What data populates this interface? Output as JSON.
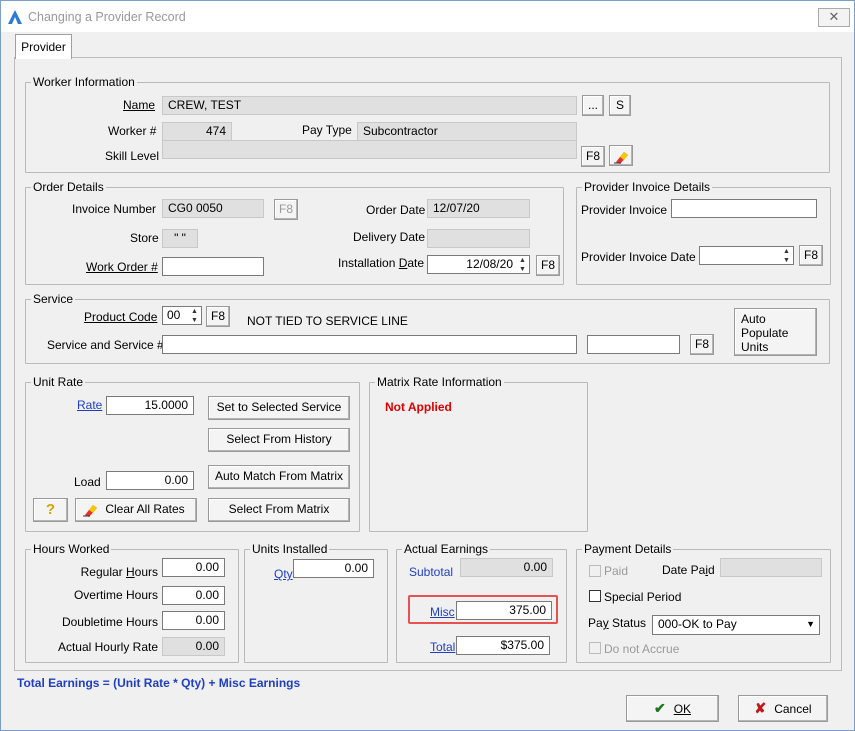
{
  "window": {
    "title": "Changing a Provider Record",
    "close_symbol": "✕"
  },
  "tabs": [
    {
      "label": "Provider"
    }
  ],
  "worker_info": {
    "title": "Worker Information",
    "name_label": "Name",
    "name_value": "CREW, TEST",
    "ellipsis_label": "...",
    "s_label": "S",
    "worker_num_label": "Worker #",
    "worker_num_value": "474",
    "pay_type_label": "Pay Type",
    "pay_type_value": "Subcontractor",
    "skill_level_label": "Skill Level",
    "skill_level_value": "",
    "f8_label": "F8"
  },
  "order_details": {
    "title": "Order Details",
    "invoice_number_label": "Invoice Number",
    "invoice_number_value": "CG0 0050",
    "f8_label": "F8",
    "store_label": "Store",
    "store_value": "\" \"",
    "work_order_label": "Work Order #",
    "work_order_value": "",
    "order_date_label": "Order Date",
    "order_date_value": "12/07/20",
    "delivery_date_label": "Delivery Date",
    "delivery_date_value": "",
    "installation_date_label": "Installation Date",
    "installation_date_value": "12/08/20",
    "f8_label2": "F8"
  },
  "provider_invoice": {
    "title": "Provider Invoice Details",
    "invoice_label": "Provider Invoice",
    "invoice_value": "",
    "invoice_date_label": "Provider Invoice Date",
    "invoice_date_value": "",
    "f8_label": "F8"
  },
  "service": {
    "title": "Service",
    "product_code_label": "Product Code",
    "product_code_value": "00",
    "f8_label": "F8",
    "not_tied_text": "NOT TIED TO SERVICE LINE",
    "service_label": "Service and Service #",
    "service_value": "",
    "service_num_value": "",
    "f8_label2": "F8",
    "auto_populate_line1": "Auto",
    "auto_populate_line2": "Populate",
    "auto_populate_line3": "Units"
  },
  "unit_rate": {
    "title": "Unit Rate",
    "rate_label": "Rate",
    "rate_value": "15.0000",
    "load_label": "Load",
    "load_value": "0.00",
    "set_selected_label": "Set to Selected Service",
    "select_history_label": "Select From History",
    "auto_match_label": "Auto Match From Matrix",
    "select_matrix_label": "Select From Matrix",
    "help_symbol": "?",
    "clear_rates_label": "Clear All Rates"
  },
  "matrix_rate": {
    "title": "Matrix Rate Information",
    "status_text": "Not Applied"
  },
  "hours_worked": {
    "title": "Hours Worked",
    "regular_label": "Regular Hours",
    "regular_value": "0.00",
    "overtime_label": "Overtime Hours",
    "overtime_value": "0.00",
    "doubletime_label": "Doubletime Hours",
    "doubletime_value": "0.00",
    "actual_rate_label": "Actual Hourly Rate",
    "actual_rate_value": "0.00"
  },
  "units_installed": {
    "title": "Units Installed",
    "qty_label": "Qty",
    "qty_value": "0.00"
  },
  "actual_earnings": {
    "title": "Actual Earnings",
    "subtotal_label": "Subtotal",
    "subtotal_value": "0.00",
    "misc_label": "Misc",
    "misc_value": "375.00",
    "total_label": "Total",
    "total_value": "$375.00"
  },
  "payment_details": {
    "title": "Payment Details",
    "paid_label": "Paid",
    "date_paid_label": "Date Paid",
    "date_paid_value": "",
    "special_period_label": "Special Period",
    "pay_status_label": "Pay Status",
    "pay_status_value": "000-OK to Pay",
    "do_not_accrue_label": "Do not Accrue"
  },
  "footer": {
    "formula_text": "Total Earnings = (Unit Rate * Qty) + Misc Earnings",
    "ok_label": "OK",
    "cancel_label": "Cancel"
  },
  "colors": {
    "link": "#1f3fbf",
    "status_red": "#e00000",
    "highlight": "#e85151",
    "footer_text": "#1f3fbf"
  }
}
